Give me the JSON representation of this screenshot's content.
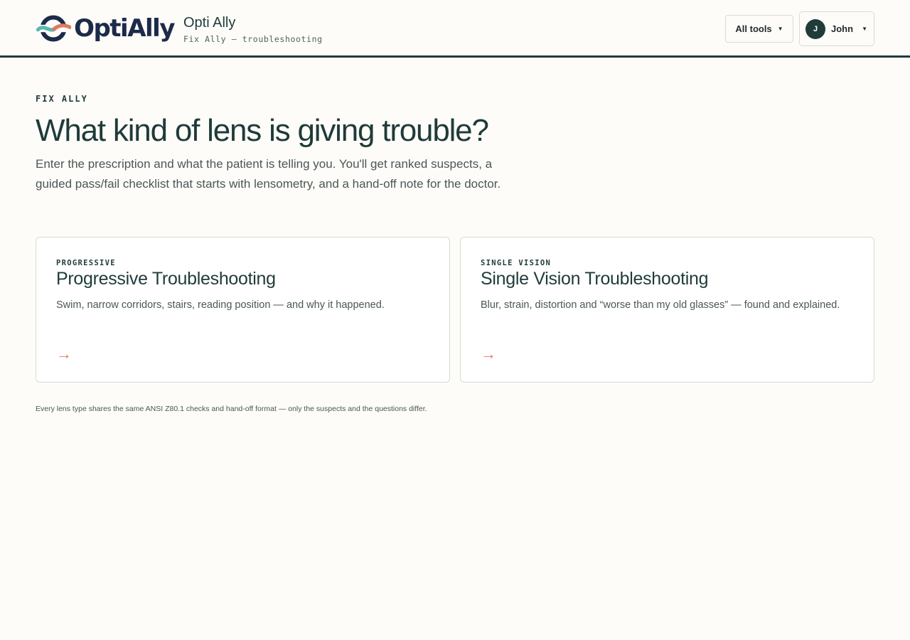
{
  "brand": {
    "logo_text": "OptiAlly",
    "colors": {
      "ring": "#1c2b4a",
      "teal": "#5ab7b5",
      "coral": "#e07a5f"
    }
  },
  "header": {
    "app_title": "Opti Ally",
    "app_subtitle": "Fix Ally — troubleshooting",
    "tools_button": "All tools",
    "user": {
      "initial": "J",
      "name": "John"
    }
  },
  "main": {
    "eyebrow": "FIX ALLY",
    "headline": "What kind of lens is giving trouble?",
    "lede": "Enter the prescription and what the patient is telling you. You'll get ranked suspects, a guided pass/fail checklist that starts with lensometry, and a hand-off note for the doctor.",
    "cards": [
      {
        "tag": "PROGRESSIVE",
        "title": "Progressive Troubleshooting",
        "description": "Swim, narrow corridors, stairs, reading position — and why it happened.",
        "arrow": "→"
      },
      {
        "tag": "SINGLE VISION",
        "title": "Single Vision Troubleshooting",
        "description": "Blur, strain, distortion and “worse than my old glasses” — found and explained.",
        "arrow": "→"
      }
    ],
    "footnote": "Every lens type shares the same ANSI Z80.1 checks and hand-off format — only the suspects and the questions differ."
  },
  "colors": {
    "accent": "#1f3b3a",
    "arrow": "#e07a5f",
    "background": "#fdfcf8"
  }
}
